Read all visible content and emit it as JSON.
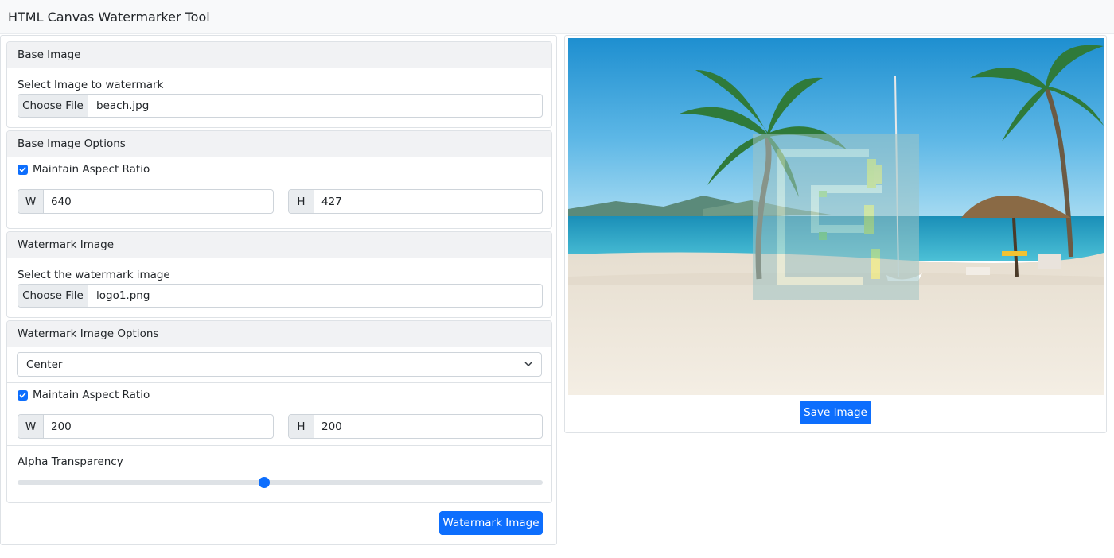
{
  "app": {
    "title": "HTML Canvas Watermarker Tool"
  },
  "base_image": {
    "header": "Base Image",
    "label": "Select Image to watermark",
    "choose_label": "Choose File",
    "file_name": "beach.jpg"
  },
  "base_options": {
    "header": "Base Image Options",
    "aspect_label": "Maintain Aspect Ratio",
    "aspect_checked": true,
    "w_label": "W",
    "w_value": "640",
    "h_label": "H",
    "h_value": "427"
  },
  "watermark_image": {
    "header": "Watermark Image",
    "label": "Select the watermark image",
    "choose_label": "Choose File",
    "file_name": "logo1.png"
  },
  "watermark_options": {
    "header": "Watermark Image Options",
    "position_selected": "Center",
    "aspect_label": "Maintain Aspect Ratio",
    "aspect_checked": true,
    "w_label": "W",
    "w_value": "200",
    "h_label": "H",
    "h_value": "200",
    "alpha_label": "Alpha Transparency",
    "alpha_fraction": 0.47
  },
  "actions": {
    "watermark_button": "Watermark Image",
    "save_button": "Save Image"
  },
  "icons": {
    "checkbox": "check-icon",
    "select": "chevron-down-icon"
  },
  "colors": {
    "primary": "#0d6efd",
    "header_bg": "#f1f2f4",
    "border": "#dee2e6"
  }
}
